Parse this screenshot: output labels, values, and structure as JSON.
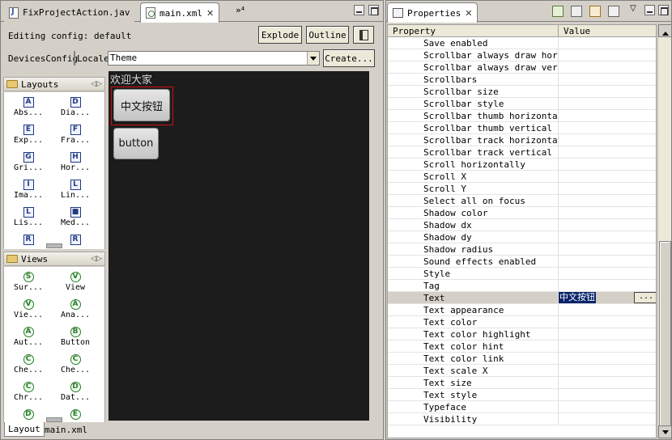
{
  "editor_tabs": [
    {
      "label": "FixProjectAction.jav",
      "icon": "java-file-icon"
    },
    {
      "label": "main.xml",
      "icon": "xml-file-icon"
    }
  ],
  "more_tabs_label": "»⁴",
  "editor": {
    "editing_config_label": "Editing config: default",
    "explode_label": "Explode",
    "outline_label": "Outline",
    "devices_config_label": "DevicesConfig",
    "locale_label": "Locale",
    "theme_value": "Theme",
    "create_label": "Create..."
  },
  "palette": {
    "layouts_label": "Layouts",
    "layouts_items": [
      {
        "letter": "A",
        "label": "Abs..."
      },
      {
        "letter": "D",
        "label": "Dia..."
      },
      {
        "letter": "E",
        "label": "Exp..."
      },
      {
        "letter": "F",
        "label": "Fra..."
      },
      {
        "letter": "G",
        "label": "Gri..."
      },
      {
        "letter": "H",
        "label": "Hor..."
      },
      {
        "letter": "I",
        "label": "Ima..."
      },
      {
        "letter": "L",
        "label": "Lin..."
      },
      {
        "letter": "L",
        "label": "Lis..."
      },
      {
        "letter": "■",
        "label": "Med..."
      },
      {
        "letter": "R",
        "label": ""
      },
      {
        "letter": "R",
        "label": ""
      }
    ],
    "views_label": "Views",
    "views_items": [
      {
        "letter": "S",
        "label": "Sur..."
      },
      {
        "letter": "V",
        "label": "View"
      },
      {
        "letter": "V",
        "label": "Vie..."
      },
      {
        "letter": "A",
        "label": "Ana..."
      },
      {
        "letter": "A",
        "label": "Aut..."
      },
      {
        "letter": "B",
        "label": "Button"
      },
      {
        "letter": "C",
        "label": "Che..."
      },
      {
        "letter": "C",
        "label": "Che..."
      },
      {
        "letter": "C",
        "label": "Chr..."
      },
      {
        "letter": "D",
        "label": "Dat..."
      },
      {
        "letter": "D",
        "label": ""
      },
      {
        "letter": "E",
        "label": ""
      }
    ]
  },
  "canvas": {
    "heading_text": "欢迎大家",
    "button1_text": "中文按钮",
    "button2_text": "button"
  },
  "bottom_tabs": [
    "Layout",
    "main.xml"
  ],
  "properties": {
    "tab_label": "Properties",
    "col_property": "Property",
    "col_value": "Value",
    "rows": [
      {
        "name": "Save enabled",
        "value": ""
      },
      {
        "name": "Scrollbar always draw horizontal",
        "value": ""
      },
      {
        "name": "Scrollbar always draw vertical",
        "value": ""
      },
      {
        "name": "Scrollbars",
        "value": ""
      },
      {
        "name": "Scrollbar size",
        "value": ""
      },
      {
        "name": "Scrollbar style",
        "value": ""
      },
      {
        "name": "Scrollbar thumb horizontal",
        "value": ""
      },
      {
        "name": "Scrollbar thumb vertical",
        "value": ""
      },
      {
        "name": "Scrollbar track horizontal",
        "value": ""
      },
      {
        "name": "Scrollbar track vertical",
        "value": ""
      },
      {
        "name": "Scroll horizontally",
        "value": ""
      },
      {
        "name": "Scroll X",
        "value": ""
      },
      {
        "name": "Scroll Y",
        "value": ""
      },
      {
        "name": "Select all on focus",
        "value": ""
      },
      {
        "name": "Shadow color",
        "value": ""
      },
      {
        "name": "Shadow dx",
        "value": ""
      },
      {
        "name": "Shadow dy",
        "value": ""
      },
      {
        "name": "Shadow radius",
        "value": ""
      },
      {
        "name": "Sound effects enabled",
        "value": ""
      },
      {
        "name": "Style",
        "value": ""
      },
      {
        "name": "Tag",
        "value": ""
      },
      {
        "name": "Text",
        "value": "中文按钮",
        "selected": true
      },
      {
        "name": "Text appearance",
        "value": ""
      },
      {
        "name": "Text color",
        "value": ""
      },
      {
        "name": "Text color highlight",
        "value": ""
      },
      {
        "name": "Text color hint",
        "value": ""
      },
      {
        "name": "Text color link",
        "value": ""
      },
      {
        "name": "Text scale X",
        "value": ""
      },
      {
        "name": "Text size",
        "value": ""
      },
      {
        "name": "Text style",
        "value": ""
      },
      {
        "name": "Typeface",
        "value": ""
      },
      {
        "name": "Visibility",
        "value": ""
      }
    ],
    "ellipsis_label": "..."
  },
  "colors": {
    "canvas_bg": "#1c1c1c",
    "selection": "#0a246a",
    "selected_outline": "#d01010"
  }
}
